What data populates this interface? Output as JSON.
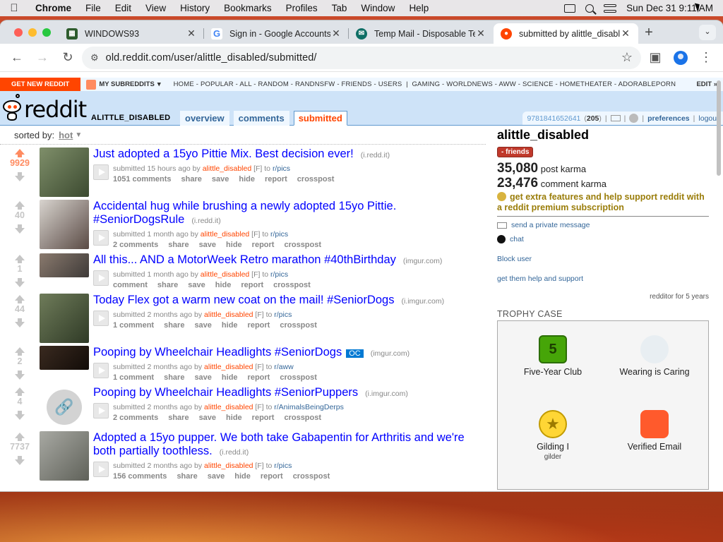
{
  "menubar": {
    "app": "Chrome",
    "items": [
      "File",
      "Edit",
      "View",
      "History",
      "Bookmarks",
      "Profiles",
      "Tab",
      "Window",
      "Help"
    ],
    "clock": "Sun Dec 31  9:11 AM"
  },
  "tabs": [
    {
      "title": "WINDOWS93",
      "active": false
    },
    {
      "title": "Sign in - Google Accounts",
      "active": false
    },
    {
      "title": "Temp Mail - Disposable Temporary Email",
      "active": false
    },
    {
      "title": "submitted by alittle_disabled",
      "active": true
    }
  ],
  "address_bar": {
    "url": "old.reddit.com/user/alittle_disabled/submitted/"
  },
  "reddit": {
    "sr_bar": {
      "get_new": "GET NEW REDDIT",
      "my_subreddits": "MY SUBREDDITS",
      "links": [
        "HOME",
        "POPULAR",
        "ALL",
        "RANDOM",
        "RANDNSFW",
        "FRIENDS",
        "USERS",
        "GAMING",
        "WORLDNEWS",
        "AWW",
        "SCIENCE",
        "HOMETHEATER",
        "ADORABLEPORN"
      ],
      "edit": "EDIT »"
    },
    "header": {
      "wordmark": "reddit",
      "page_name": "ALITTLE_DISABLED",
      "tabs": [
        "overview",
        "comments",
        "submitted"
      ],
      "selected_tab": "submitted",
      "user": "9781841652641",
      "user_karma": "205",
      "preferences": "preferences",
      "logout": "logout"
    },
    "sort": {
      "label": "sorted by:",
      "value": "hot"
    },
    "posts": [
      {
        "score": "9929",
        "liked": true,
        "title": "Just adopted a 15yo Pittie Mix. Best decision ever!",
        "domain": "(i.redd.it)",
        "time": "15 hours ago",
        "author": "alittle_disabled",
        "flair": "[F]",
        "subreddit": "r/pics",
        "comments": "1051 comments",
        "thumb_colors": [
          "#7f8f6a",
          "#3c4a30"
        ]
      },
      {
        "score": "40",
        "liked": false,
        "title": "Accidental hug while brushing a newly adopted 15yo Pittie. #SeniorDogsRule",
        "domain": "(i.redd.it)",
        "time": "1 month ago",
        "author": "alittle_disabled",
        "flair": "[F]",
        "subreddit": "r/pics",
        "comments": "2 comments",
        "thumb_colors": [
          "#d8d4cf",
          "#5a4a44"
        ]
      },
      {
        "score": "1",
        "liked": false,
        "title": "All this... AND a MotorWeek Retro marathon #40thBirthday",
        "domain": "(imgur.com)",
        "time": "1 month ago",
        "author": "alittle_disabled",
        "flair": "[F]",
        "subreddit": "r/pics",
        "comments": "comment",
        "thumb_colors": [
          "#8a7a6e",
          "#3e3a38"
        ],
        "short": true
      },
      {
        "score": "44",
        "liked": false,
        "title": "Today Flex got a warm new coat on the mail! #SeniorDogs",
        "domain": "(i.imgur.com)",
        "time": "2 months ago",
        "author": "alittle_disabled",
        "flair": "[F]",
        "subreddit": "r/pics",
        "comments": "1 comment",
        "thumb_colors": [
          "#6f7c5a",
          "#2f3a26"
        ]
      },
      {
        "score": "2",
        "liked": false,
        "title": "Pooping by Wheelchair Headlights #SeniorDogs",
        "oc": "OC",
        "domain": "(imgur.com)",
        "time": "2 months ago",
        "author": "alittle_disabled",
        "flair": "[F]",
        "subreddit": "r/aww",
        "comments": "1 comment",
        "thumb_colors": [
          "#3a2a20",
          "#120c08"
        ],
        "short": true
      },
      {
        "score": "4",
        "liked": false,
        "title": "Pooping by Wheelchair Headlights #SeniorPuppers",
        "domain": "(i.imgur.com)",
        "time": "2 months ago",
        "author": "alittle_disabled",
        "flair": "[F]",
        "subreddit": "r/AnimalsBeingDerps",
        "comments": "2 comments",
        "link_thumb": true
      },
      {
        "score": "7737",
        "liked": false,
        "title": "Adopted a 15yo pupper. We both take Gabapentin for Arthritis and we're both partially toothless.",
        "domain": "(i.redd.it)",
        "time": "2 months ago",
        "author": "alittle_disabled",
        "flair": "[F]",
        "subreddit": "r/pics",
        "comments": "156 comments",
        "thumb_colors": [
          "#a8a9a3",
          "#5f6159"
        ]
      }
    ],
    "post_actions": [
      "share",
      "save",
      "hide",
      "report",
      "crosspost"
    ],
    "sidebar": {
      "username": "alittle_disabled",
      "friend_label": "- friends",
      "post_karma": "35,080",
      "post_karma_label": "post karma",
      "comment_karma": "23,476",
      "comment_karma_label": "comment karma",
      "premium_text": "get extra features and help support reddit with a reddit premium subscription",
      "send_message": "send a private message",
      "chat": "chat",
      "block": "Block user",
      "help": "get them help and support",
      "age": "redditor for 5 years",
      "trophy_case_label": "TROPHY CASE",
      "trophies": [
        {
          "name": "Five-Year Club",
          "icon": "five-year-club-icon"
        },
        {
          "name": "Wearing is Caring",
          "icon": "wearing-is-caring-icon"
        },
        {
          "name": "Gilding I",
          "sub": "gilder",
          "icon": "gilding-icon"
        },
        {
          "name": "Verified Email",
          "icon": "verified-email-icon"
        }
      ]
    }
  }
}
